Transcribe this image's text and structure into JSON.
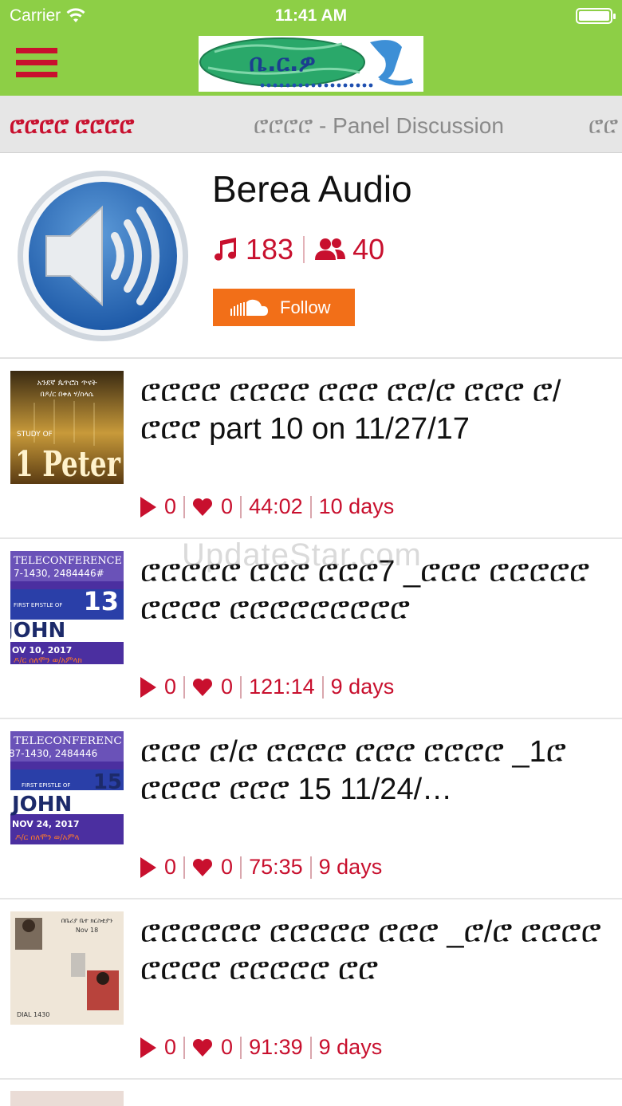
{
  "status_bar": {
    "carrier": "Carrier",
    "time": "11:41 AM"
  },
  "nav": {
    "menu_icon": "hamburger-menu-icon",
    "logo_text": "ቤ.ር.ዎ"
  },
  "tabs": [
    {
      "label": "ሮሮሮሮ ሮሮሮሮ",
      "active": true
    },
    {
      "label": "ሮሮሮሮ - Panel Discussion",
      "active": false
    },
    {
      "label": "ሮሮ",
      "active": false
    }
  ],
  "profile": {
    "name": "Berea Audio",
    "tracks_count": "183",
    "followers_count": "40",
    "follow_label": "Follow",
    "avatar_icon": "speaker-icon"
  },
  "feed": [
    {
      "title": "ሮሮሮሮ ሮሮሮሮ ሮሮሮ ሮሮ/ሮ ሮሮሮ ሮ/ሮሮሮ part 10 on 11/27/17",
      "plays": "0",
      "likes": "0",
      "duration": "44:02",
      "age": "10 days",
      "thumb": {
        "top": "አንደኛ ጴጥሮስ ጥናት",
        "sub": "በዶ/ር በቀለ ሃ/ስላሴ",
        "small": "STUDY OF",
        "big": "1 Peter"
      }
    },
    {
      "title": "ሮሮሮሮሮ ሮሮሮ ሮሮሮ7 _ሮሮሮ ሮሮሮሮሮ ሮሮሮሮ ሮሮሮሮሮሮሮሮሮ",
      "plays": "0",
      "likes": "0",
      "duration": "121:14",
      "age": "9 days",
      "thumb": {
        "line1": "TELECONFERENCE",
        "line2": "7-1430, 2484446#",
        "num": "13",
        "epistle": "FIRST EPISTLE OF",
        "book": "JOHN",
        "date": "OV 10, 2017",
        "speaker": "ዶ/ር ሰለሞን ወ/አምላክ"
      }
    },
    {
      "title": "ሮሮሮ ሮ/ሮ ሮሮሮሮ ሮሮሮ ሮሮሮሮ _1ሮ ሮሮሮሮ ሮሮሮ 15 11/24/…",
      "plays": "0",
      "likes": "0",
      "duration": "75:35",
      "age": "9 days",
      "thumb": {
        "line1": "TELECONFERENC",
        "line2": "87-1430, 2484446",
        "num": "15",
        "epistle": "FIRST EPISTLE OF",
        "book": "JOHN",
        "date": "NOV 24, 2017",
        "speaker": "ዶ/ር ሰለሞን ወ/አምላ"
      }
    },
    {
      "title": "ሮሮሮሮሮሮ ሮሮሮሮሮ ሮሮሮ _ሮ/ሮ ሮሮሮሮ ሮሮሮሮ ሮሮሮሮሮ ሮሮ",
      "plays": "0",
      "likes": "0",
      "duration": "91:39",
      "age": "9 days",
      "thumb": {
        "line1": "በቤሪያ ቤተ ክርስቲያን",
        "line2": "Nov 18",
        "line3": "DIAL 1430"
      }
    }
  ],
  "watermark": "UpdateStar.com",
  "colors": {
    "nav_green": "#8dcf46",
    "accent_red": "#c8102e",
    "follow_orange": "#f26f18"
  }
}
